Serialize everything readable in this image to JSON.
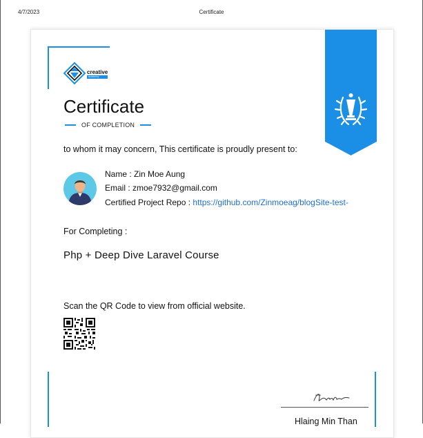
{
  "print_header": {
    "date": "4/7/2023",
    "title": "Certificate"
  },
  "logo": {
    "word": "creative",
    "sub": "academy",
    "icon": "diamond-logo-icon"
  },
  "certificate": {
    "title": "Certificate",
    "subtitle": "OF COMPLETION",
    "intro": "to whom it may concern, This certificate is proudly present to:",
    "name_line": "Name : Zin Moe Aung",
    "email_line": "Email : zmoe7932@gmail.com",
    "repo_label": "Certified Project Repo : ",
    "repo_link": "https://github.com/Zinmoeag/blogSite-test-",
    "for_completing": "For Completing :",
    "course": "Php + Deep Dive Laravel Course",
    "scan_text": "Scan the QR Code to view from official website.",
    "signer": "Hlaing Min Than"
  },
  "colors": {
    "accent": "#1a8fe5",
    "link": "#1f6fd1"
  },
  "icons": [
    "avatar-icon",
    "trophy-laurel-icon",
    "qr-code-icon",
    "signature-icon"
  ]
}
